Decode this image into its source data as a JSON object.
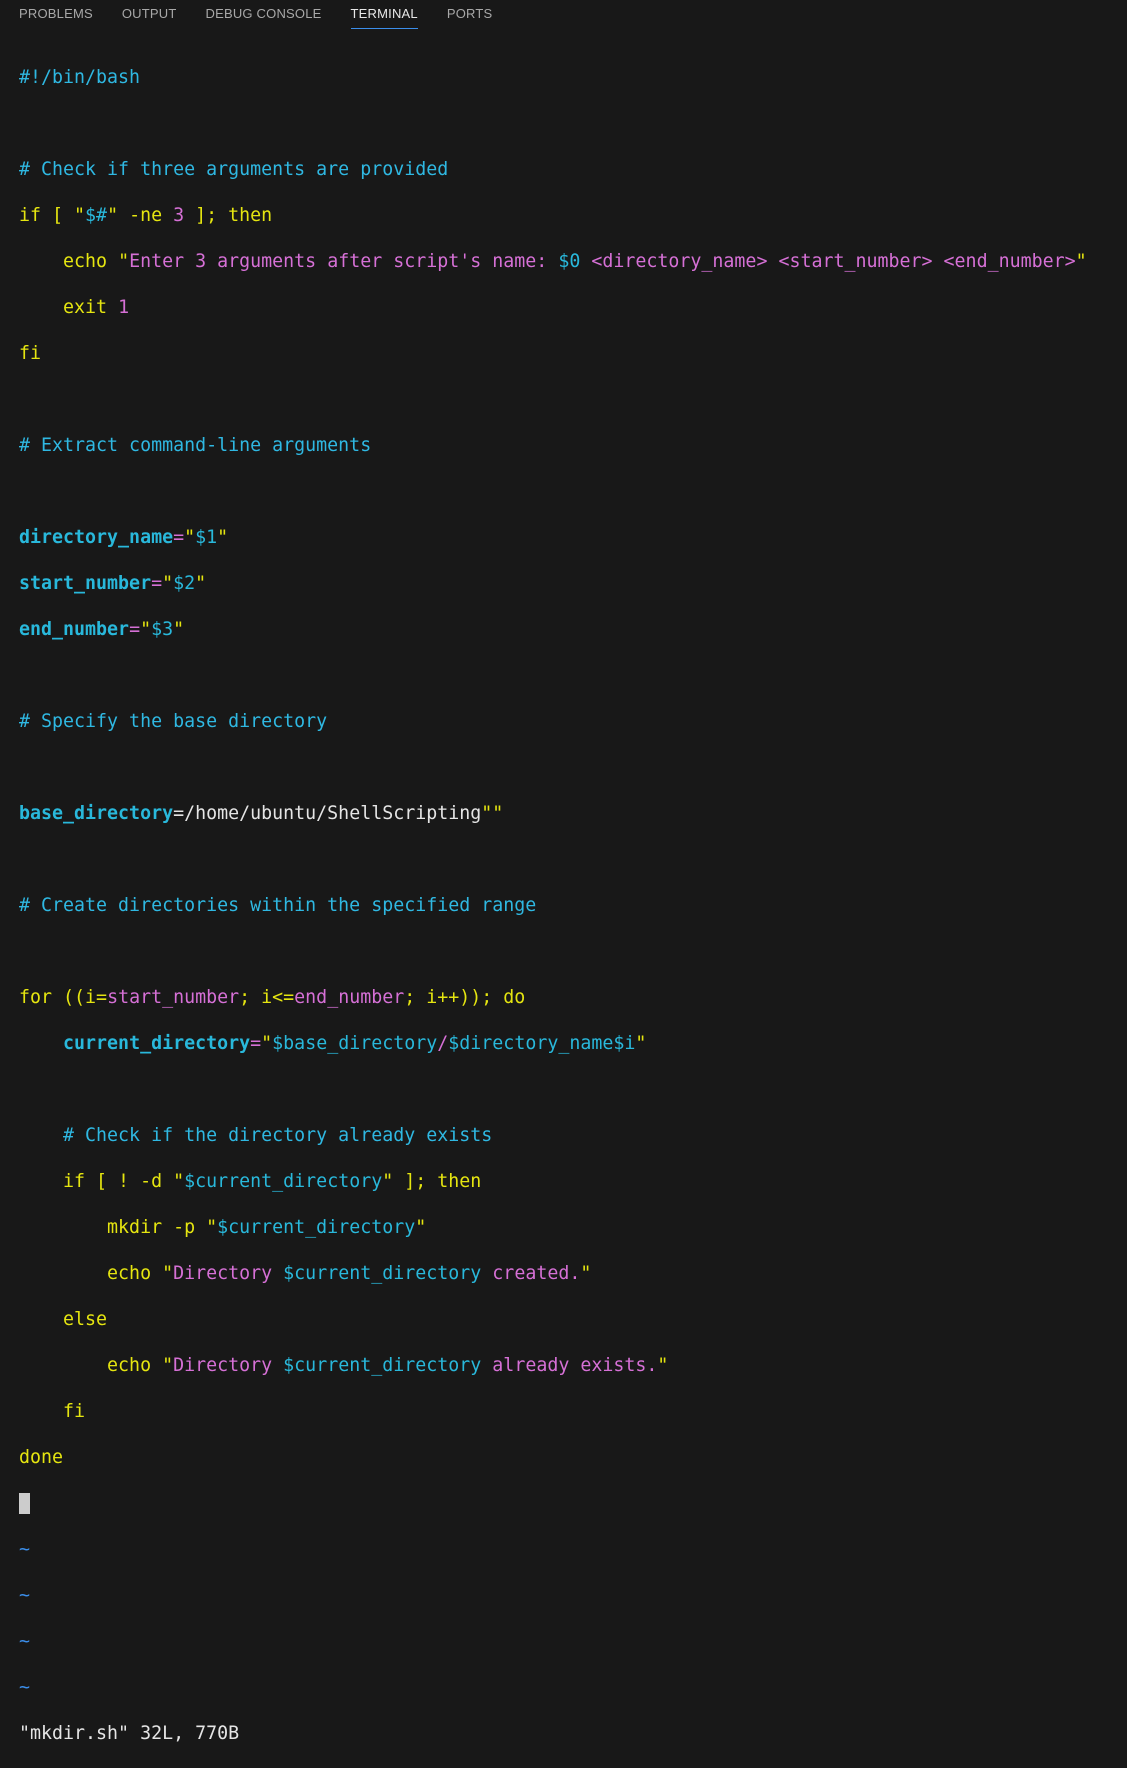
{
  "tabs": [
    {
      "label": "PROBLEMS"
    },
    {
      "label": "OUTPUT"
    },
    {
      "label": "DEBUG CONSOLE"
    },
    {
      "label": "TERMINAL",
      "active": true
    },
    {
      "label": "PORTS"
    }
  ],
  "terminal": {
    "shebang": "#!/bin/bash",
    "cmt_check_args": "# Check if three arguments are provided",
    "if1_kw": "if [ ",
    "if1_q1": "\"",
    "if1_var": "$#",
    "if1_q2": "\"",
    "if1_rest": " -ne ",
    "if1_num": "3",
    "if1_end": " ]; then",
    "echo1_kw": "    echo ",
    "echo1_q1": "\"",
    "echo1_text1": "Enter 3 arguments after script's name: ",
    "echo1_var": "$0",
    "echo1_text2": " <directory_name> <start_number> <end_number>",
    "echo1_q2": "\"",
    "exit_kw": "    exit ",
    "exit_num": "1",
    "fi1": "fi",
    "cmt_extract": "# Extract command-line arguments",
    "dir_name_var": "directory_name",
    "dir_name_eq": "=",
    "dir_name_q1": "\"",
    "dir_name_val": "$1",
    "dir_name_q2": "\"",
    "start_var": "start_number",
    "start_eq": "=",
    "start_q1": "\"",
    "start_val": "$2",
    "start_q2": "\"",
    "end_var": "end_number",
    "end_eq": "=",
    "end_q1": "\"",
    "end_val": "$3",
    "end_q2": "\"",
    "cmt_base": "# Specify the base directory",
    "base_var": "base_directory",
    "base_val": "=/home/ubuntu/ShellScripting",
    "base_q": "\"\"",
    "cmt_create": "# Create directories within the specified range",
    "for_kw": "for ((i=",
    "for_v1": "start_number",
    "for_mid": "; i<=",
    "for_v2": "end_number",
    "for_end": "; i++)); do",
    "cur_indent": "    ",
    "cur_var": "current_directory",
    "cur_eq": "=",
    "cur_q1": "\"",
    "cur_v1": "$base_directory",
    "cur_slash": "/",
    "cur_v2": "$directory_name",
    "cur_v3": "$i",
    "cur_q2": "\"",
    "cmt_exists": "    # Check if the directory already exists",
    "if2_kw": "    if [ ! -d ",
    "if2_q1": "\"",
    "if2_var": "$current_directory",
    "if2_q2": "\"",
    "if2_end": " ]; then",
    "mkdir_kw": "        mkdir -p ",
    "mkdir_q1": "\"",
    "mkdir_var": "$current_directory",
    "mkdir_q2": "\"",
    "echo2_kw": "        echo ",
    "echo2_q1": "\"",
    "echo2_t1": "Directory ",
    "echo2_var": "$current_directory",
    "echo2_t2": " created.",
    "echo2_q2": "\"",
    "else_kw": "    else",
    "echo3_kw": "        echo ",
    "echo3_q1": "\"",
    "echo3_t1": "Directory ",
    "echo3_var": "$current_directory",
    "echo3_t2": " already exists.",
    "echo3_q2": "\"",
    "fi2": "    fi",
    "done": "done",
    "tilde": "~",
    "status_line": "\"mkdir.sh\" 32L, 770B"
  }
}
